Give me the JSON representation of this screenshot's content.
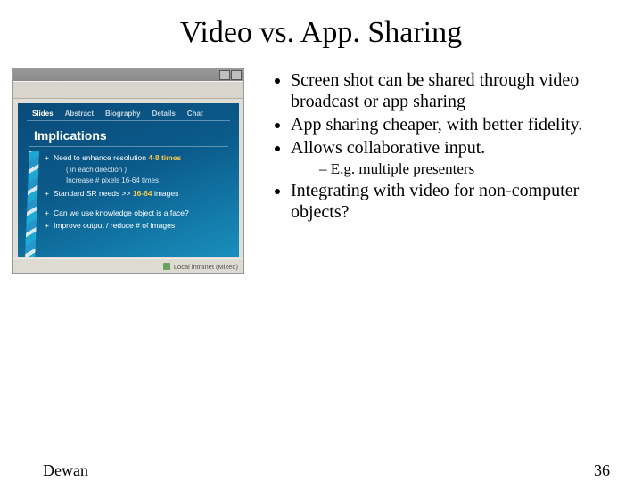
{
  "title": "Video vs. App. Sharing",
  "bullets": {
    "b1": "Screen shot can be shared through video broadcast or app sharing",
    "b2": "App sharing cheaper, with better fidelity.",
    "b3": "Allows collaborative input.",
    "b3_1": "E.g. multiple presenters",
    "b4": "Integrating with video for non-computer objects?"
  },
  "thumb": {
    "tabs": {
      "t1": "Slides",
      "t2": "Abstract",
      "t3": "Biography",
      "t4": "Details",
      "t5": "Chat"
    },
    "heading": "Implications",
    "lines": {
      "l1a": "Need to enhance resolution ",
      "l1b": "4-8 times",
      "l1s": "( in each direction )",
      "l2a": "Increase # pixels 16-64 times",
      "l3a": "Standard SR needs >> ",
      "l3b": "16-64",
      "l3c": " images",
      "l4a": "Can we use knowledge object is a face?",
      "l5a": "Improve output / reduce # of images"
    },
    "status": "Local intranet (Mixed)"
  },
  "footer": {
    "author": "Dewan",
    "page": "36"
  }
}
